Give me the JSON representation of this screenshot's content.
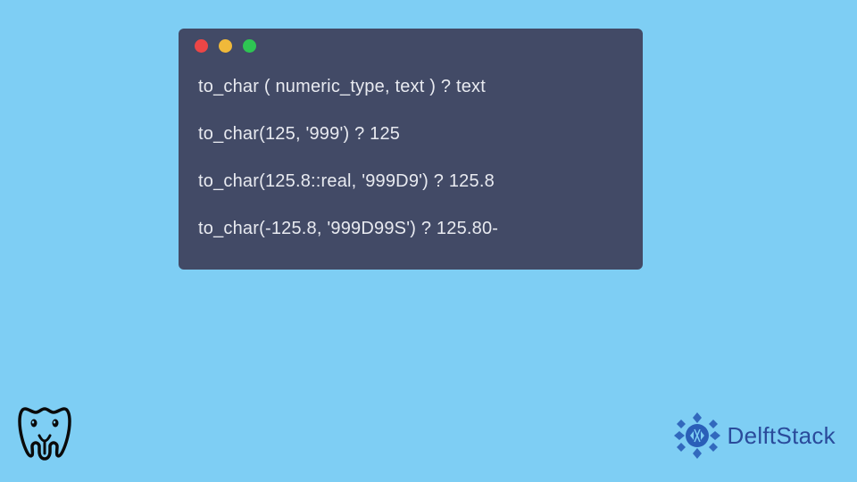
{
  "window": {
    "dots": {
      "red": "#ec4646",
      "yellow": "#f0b93a",
      "green": "#2ec553"
    }
  },
  "code": {
    "lines": [
      "to_char ( numeric_type, text ) ? text",
      "to_char(125, '999') ? 125",
      "to_char(125.8::real, '999D9') ? 125.8",
      "to_char(-125.8, '999D99S') ? 125.80-"
    ]
  },
  "brand": {
    "name": "DelftStack"
  },
  "icons": {
    "elephant": "postgresql-elephant-icon",
    "delft": "delftstack-logo-icon"
  }
}
